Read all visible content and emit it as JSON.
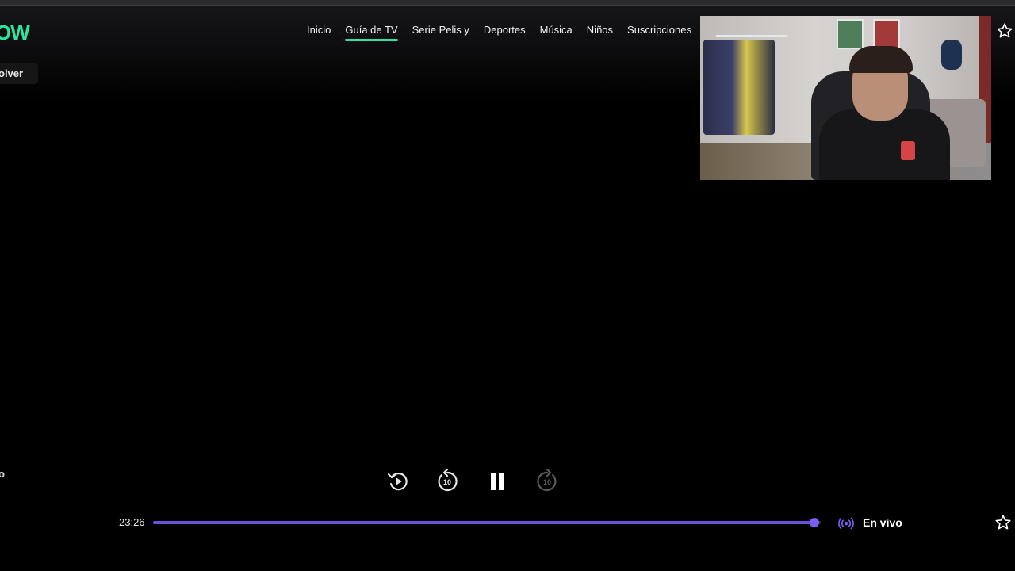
{
  "brand": {
    "logo_text": "OW",
    "accent_color": "#2fe3a0"
  },
  "header": {
    "back_label": "olver",
    "nav": [
      {
        "label": "Inicio",
        "active": false
      },
      {
        "label": "Guía de TV",
        "active": true
      },
      {
        "label": "Serie Pelis y",
        "active": false
      },
      {
        "label": "Deportes",
        "active": false
      },
      {
        "label": "Música",
        "active": false
      },
      {
        "label": "Niños",
        "active": false
      },
      {
        "label": "Suscripciones",
        "active": false
      }
    ],
    "favorite_icon": "star-outline-icon"
  },
  "player": {
    "left_stub_text": "o",
    "controls": {
      "restart_icon": "restart-play-icon",
      "rewind_icon": "rewind-10-icon",
      "rewind_seconds": "10",
      "pause_icon": "pause-icon",
      "forward_icon": "forward-10-icon",
      "forward_seconds": "10",
      "forward_enabled": false
    },
    "progress": {
      "time": "23:26",
      "fraction": 0.99,
      "fill_color": "#6b4fd8"
    },
    "live": {
      "icon": "live-broadcast-icon",
      "label": "En vivo"
    },
    "favorite_icon": "star-outline-icon"
  },
  "webcam_overlay": {
    "visible": true
  }
}
